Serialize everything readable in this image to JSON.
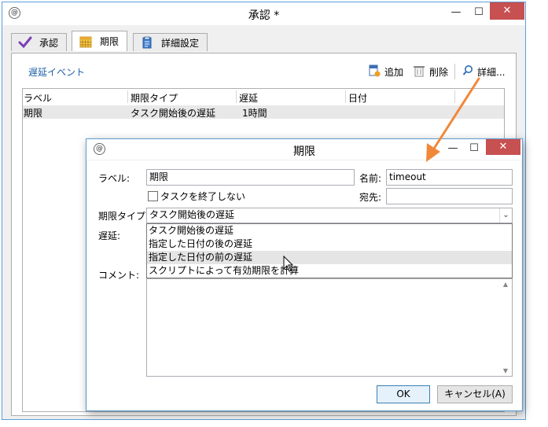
{
  "main_window": {
    "title": "承認 *",
    "app_icon": "@",
    "tabs": [
      {
        "label": "承認",
        "icon": "checkmark-icon"
      },
      {
        "label": "期限",
        "icon": "calendar-icon"
      },
      {
        "label": "詳細設定",
        "icon": "clipboard-icon"
      }
    ],
    "section_title": "遅延イベント",
    "toolbar": {
      "add": "追加",
      "delete": "削除",
      "detail": "詳細..."
    },
    "columns": [
      "ラベル",
      "期限タイプ",
      "遅延",
      "日付"
    ],
    "rows": [
      {
        "label": "期限",
        "type": "タスク開始後の遅延",
        "delay": "1時間",
        "date": ""
      }
    ]
  },
  "dialog": {
    "title": "期限",
    "app_icon": "@",
    "label_caption": "ラベル:",
    "label_value": "期限",
    "name_caption": "名前:",
    "name_value": "timeout",
    "checkbox_label": "タスクを終了しない",
    "recipient_caption": "宛先:",
    "recipient_value": "",
    "type_caption": "期限タイプ:",
    "type_value": "タスク開始後の遅延",
    "options": [
      "タスク開始後の遅延",
      "指定した日付の後の遅延",
      "指定した日付の前の遅延",
      "スクリプトによって有効期限を計算"
    ],
    "delay_caption": "遅延:",
    "comment_caption": "コメント:",
    "ok_label": "OK",
    "cancel_label": "キャンセル(A)"
  },
  "colors": {
    "accent": "#5c9ed6",
    "close_red": "#c75050",
    "arrow_orange": "#f0883a",
    "link_blue": "#1e5fa8"
  }
}
